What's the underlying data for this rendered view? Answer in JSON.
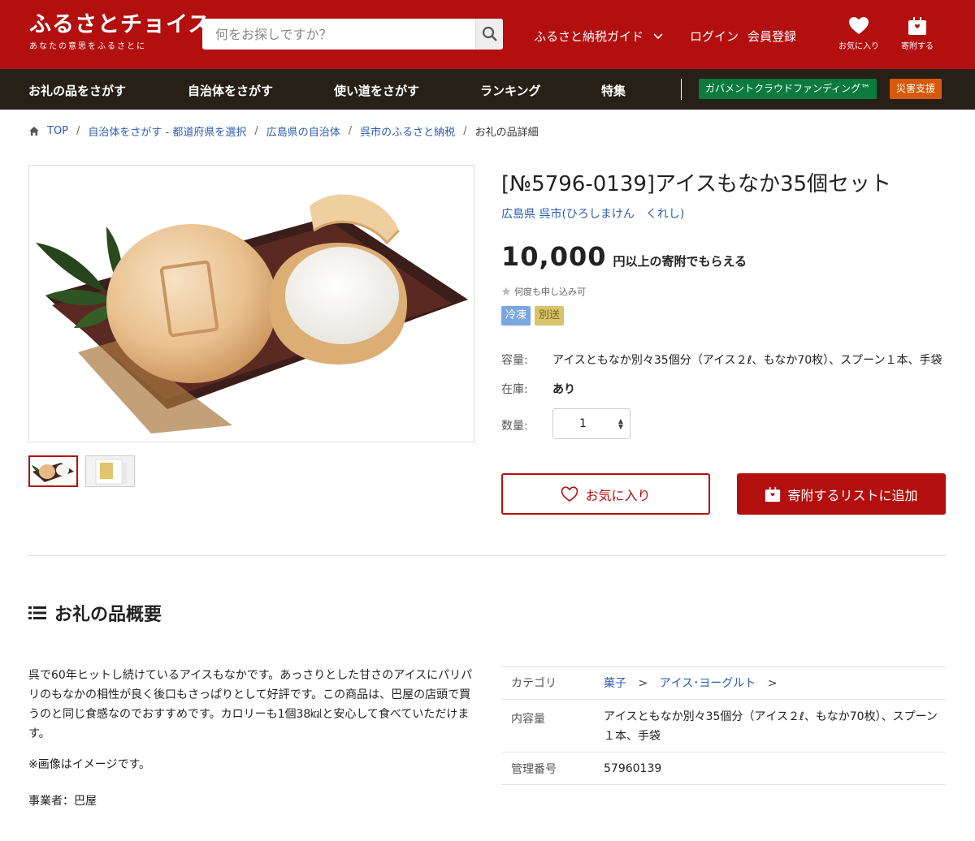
{
  "header": {
    "logo_text": "ふるさとチョイス",
    "logo_sub": "あなたの意思をふるさとに",
    "search_placeholder": "何をお探しですか？",
    "guide_label": "ふるさと納税ガイド",
    "login_label": "ログイン",
    "register_label": "会員登録",
    "favorites_label": "お気に入り",
    "donate_label": "寄附する"
  },
  "nav": {
    "items": [
      "お礼の品をさがす",
      "自治体をさがす",
      "使い道をさがす",
      "ランキング",
      "特集"
    ],
    "gcf_label": "ガバメントクラウドファンディング™",
    "disaster_label": "災害支援"
  },
  "breadcrumb": {
    "items": [
      "TOP",
      "自治体をさがす - 都道府県を選択",
      "広島県の自治体",
      "呉市のふるさと納税"
    ],
    "current": "お礼の品詳細"
  },
  "product": {
    "title": "[№5796-0139]アイスもなか35個セット",
    "municipality": "広島県 呉市(ひろしまけん　くれし)",
    "price": "10,000",
    "price_suffix": "円以上の寄附でもらえる",
    "repeat_note": "何度も申し込み可",
    "tags": [
      "冷凍",
      "別送"
    ],
    "capacity_label": "容量:",
    "capacity_value": "アイスともなか別々35個分（アイス２ℓ、もなか70枚）、スプーン１本、手袋",
    "stock_label": "在庫:",
    "stock_value": "あり",
    "quantity_label": "数量:",
    "quantity_value": "1",
    "fav_button": "お気に入り",
    "add_button": "寄附するリストに追加"
  },
  "overview": {
    "title": "お礼の品概要",
    "description": "呉で60年ヒットし続けているアイスもなかです。あっさりとした甘さのアイスにパリパリのもなかの相性が良く後口もさっぱりとして好評です。この商品は、巴屋の店頭で買うのと同じ食感なのでおすすめです。カロリーも1個38㎉と安心して食べていただけます。",
    "note": "※画像はイメージです。",
    "maker": "事業者：巴屋",
    "table": {
      "category_label": "カテゴリ",
      "category_items": [
        "菓子",
        "アイス･ヨーグルト"
      ],
      "content_label": "内容量",
      "content_value": "アイスともなか別々35個分（アイス２ℓ、もなか70枚）、スプーン１本、手袋",
      "id_label": "管理番号",
      "id_value": "57960139"
    }
  },
  "colors": {
    "brand_red": "#b40f0f",
    "nav_dark": "#262017",
    "link_blue": "#2a5db0",
    "gcf_green": "#0b7a3e",
    "disaster_orange": "#d9590b",
    "tag_frozen": "#7aa7e0",
    "tag_separate": "#d8c46a"
  }
}
